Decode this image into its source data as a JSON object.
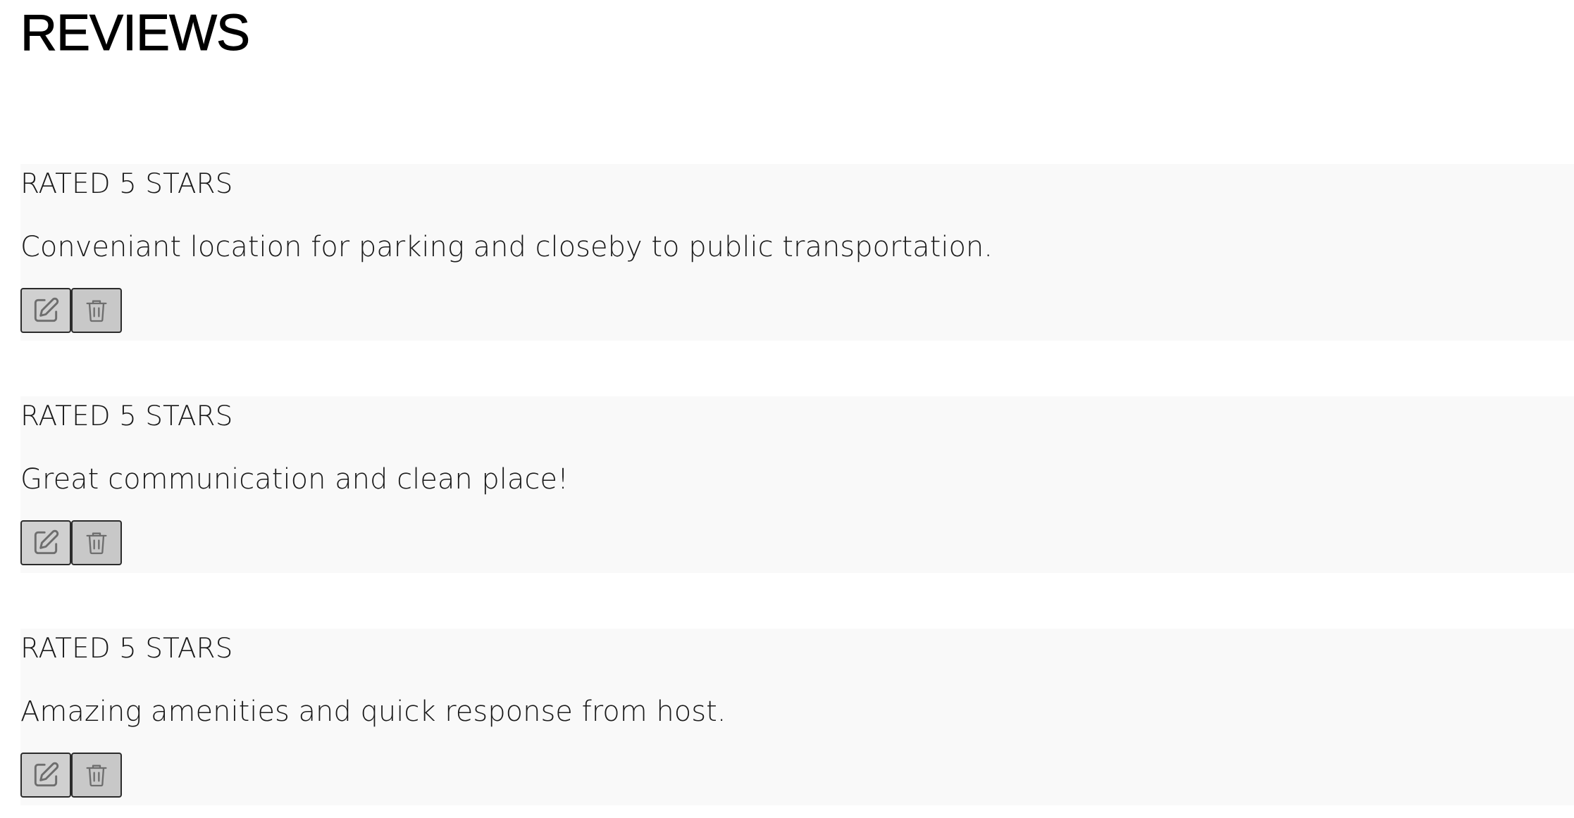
{
  "page": {
    "title": "REVIEWS"
  },
  "reviews": [
    {
      "rating_text": "RATED 5 STARS",
      "comment": "Conveniant location for parking and closeby to public transportation.",
      "edit_icon": "edit-icon",
      "delete_icon": "trash-icon"
    },
    {
      "rating_text": "RATED 5 STARS",
      "comment": "Great communication and clean place!",
      "edit_icon": "edit-icon",
      "delete_icon": "trash-icon"
    },
    {
      "rating_text": "RATED 5 STARS",
      "comment": "Amazing amenities and quick response from host.",
      "edit_icon": "edit-icon",
      "delete_icon": "trash-icon"
    }
  ],
  "colors": {
    "card_background": "#f9f9f9",
    "button_background": "#d0d0d0",
    "button_border": "#2b2b2b",
    "icon_stroke": "#6e6e6e"
  }
}
